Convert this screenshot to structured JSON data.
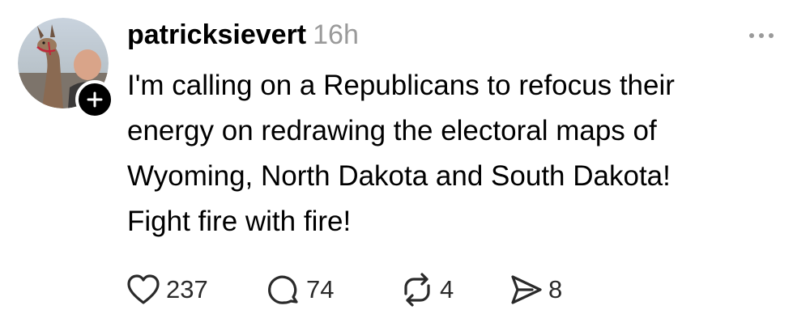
{
  "post": {
    "username": "patricksievert",
    "timestamp": "16h",
    "lines": [
      "I'm calling on a Republicans to refocus their",
      "energy on redrawing the electoral maps of",
      "Wyoming, North Dakota and South Dakota!",
      "Fight fire with fire!"
    ],
    "actions": {
      "likes": "237",
      "replies": "74",
      "reposts": "4",
      "shares": "8"
    }
  },
  "icons": {
    "avatar": "profile-photo",
    "follow": "plus-icon",
    "more": "ellipsis-icon",
    "like": "heart-icon",
    "reply": "speech-bubble-icon",
    "repost": "repost-arrows-icon",
    "share": "send-arrow-icon"
  },
  "colors": {
    "text": "#000000",
    "muted": "#9a9a9a",
    "icon": "#2a2a2a",
    "badge": "#000000"
  }
}
